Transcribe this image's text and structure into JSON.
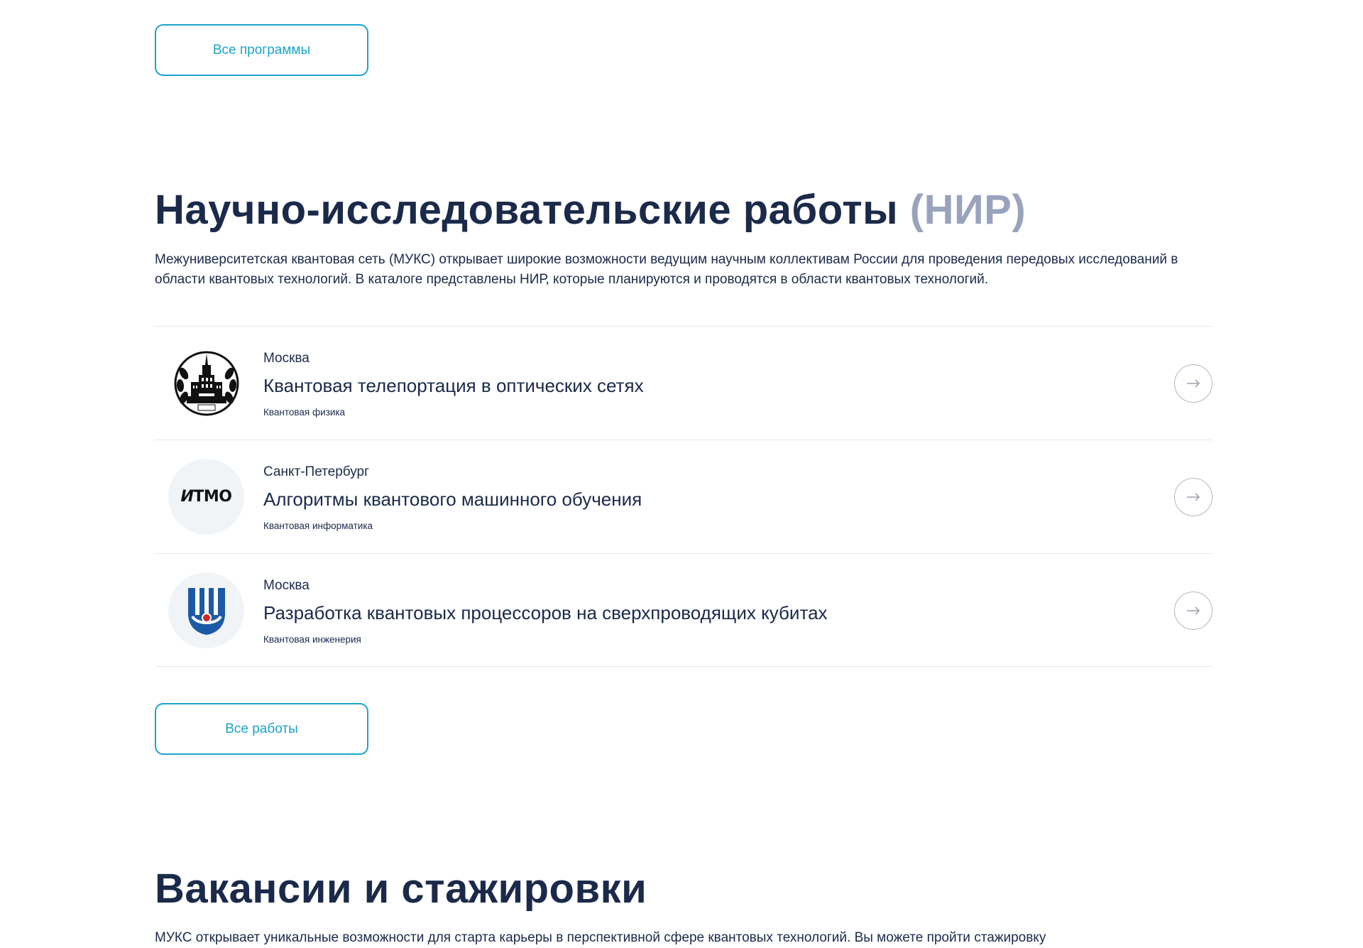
{
  "programs": {
    "all_programs_label": "Все программы"
  },
  "research": {
    "title": "Научно-исследовательские работы",
    "title_muted": "(НИР)",
    "description": "Межуниверситетская квантовая сеть (МУКС) открывает широкие возможности ведущим научным коллективам России для проведения передовых исследований в области квантовых технологий. В каталоге представлены НИР, которые планируются и проводятся в области квантовых технологий.",
    "items": [
      {
        "city": "Москва",
        "title": "Квантовая телепортация в оптических сетях",
        "tag": "Квантовая физика",
        "logo": "msu-emblem-icon"
      },
      {
        "city": "Санкт-Петербург",
        "title": "Алгоритмы квантового машинного обучения",
        "tag": "Квантовая информатика",
        "logo": "itmo-logo-icon",
        "logo_text": "ИTMO"
      },
      {
        "city": "Москва",
        "title": "Разработка квантовых процессоров на сверхпроводящих кубитах",
        "tag": "Квантовая инженерия",
        "logo": "university-shield-icon"
      }
    ],
    "all_works_label": "Все работы"
  },
  "vacancies": {
    "title": "Вакансии и стажировки",
    "description": "МУКС открывает уникальные возможности для старта карьеры в перспективной сфере квантовых технологий. Вы можете пройти стажировку"
  },
  "colors": {
    "accent": "#1ba3cc",
    "heading": "#1b2a4a",
    "muted": "#9aa3bd",
    "shield_blue": "#1c5aa6",
    "shield_red": "#d6262b"
  }
}
